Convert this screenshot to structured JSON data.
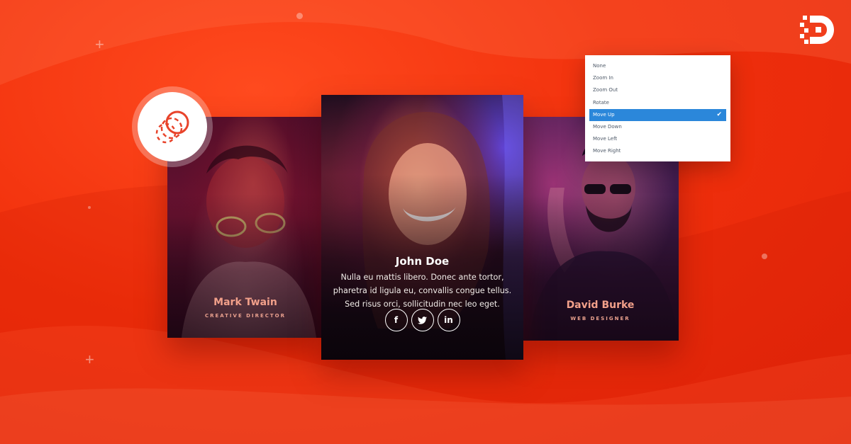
{
  "brand": {
    "logo_icon": "divi-d-logo-icon",
    "background_color": "#f42f0c"
  },
  "module_badge": {
    "icon": "hover-effect-circles-icon",
    "accent": "#e8432a"
  },
  "hover_dropdown": {
    "options": [
      "None",
      "Zoom In",
      "Zoom Out",
      "Rotate",
      "Move Up",
      "Move Down",
      "Move Left",
      "Move Right"
    ],
    "selected": "Move Up",
    "selected_color": "#2b87da"
  },
  "team": {
    "left": {
      "name": "Mark Twain",
      "role": "CREATIVE DIRECTOR"
    },
    "center": {
      "name": "John Doe",
      "bio": "Nulla eu mattis libero. Donec ante tortor, pharetra id ligula eu, convallis congue tellus. Sed risus orci, sollicitudin nec leo eget.",
      "social": [
        {
          "icon": "facebook-icon",
          "glyph": "f"
        },
        {
          "icon": "twitter-icon",
          "glyph": ""
        },
        {
          "icon": "linkedin-icon",
          "glyph": "in"
        }
      ]
    },
    "right": {
      "name": "David Burke",
      "role": "WEB DESIGNER"
    }
  }
}
